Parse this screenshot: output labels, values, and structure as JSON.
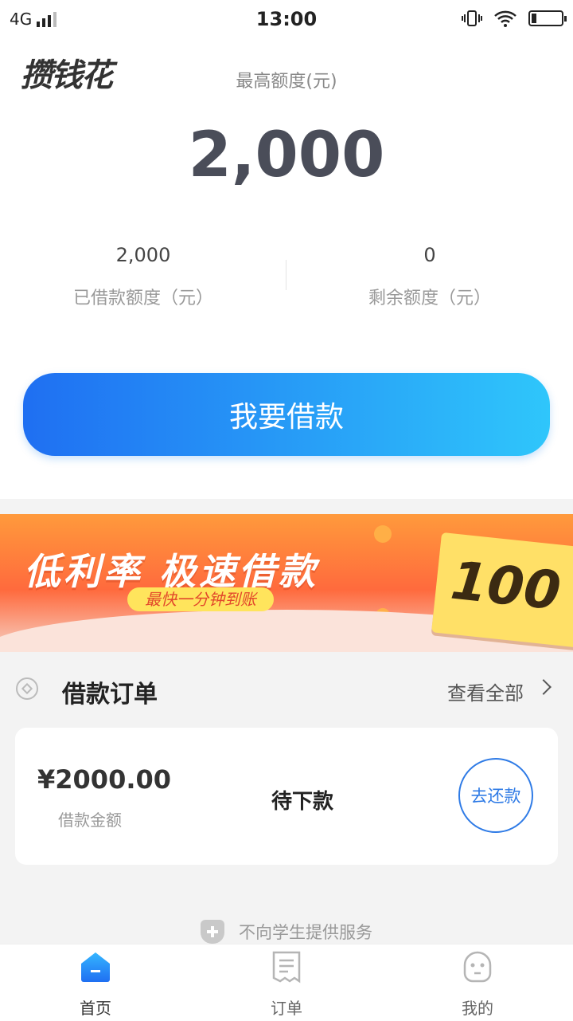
{
  "status_bar": {
    "network": "4G",
    "time": "13:00"
  },
  "app": {
    "logo": "攒钱花"
  },
  "limit": {
    "label": "最高额度(元)",
    "value": "2,000",
    "borrowed_value": "2,000",
    "borrowed_label": "已借款额度（元）",
    "remaining_value": "0",
    "remaining_label": "剩余额度（元）"
  },
  "actions": {
    "borrow_label": "我要借款"
  },
  "banner": {
    "headline": "低利率 极速借款",
    "subline": "最快一分钟到账",
    "ticket_value": "100"
  },
  "orders": {
    "title": "借款订单",
    "view_all": "查看全部",
    "items": [
      {
        "amount": "¥2000.00",
        "amount_label": "借款金额",
        "status": "待下款",
        "action": "去还款"
      }
    ]
  },
  "notice": "不向学生提供服务",
  "tabbar": {
    "items": [
      {
        "label": "首页",
        "icon": "home-icon",
        "active": true
      },
      {
        "label": "订单",
        "icon": "receipt-icon",
        "active": false
      },
      {
        "label": "我的",
        "icon": "profile-icon",
        "active": false
      }
    ]
  },
  "colors": {
    "accent": "#1f6ff2",
    "accent_light": "#2fc6fb",
    "repay": "#2f7be6",
    "banner": "#ff7a3d"
  }
}
